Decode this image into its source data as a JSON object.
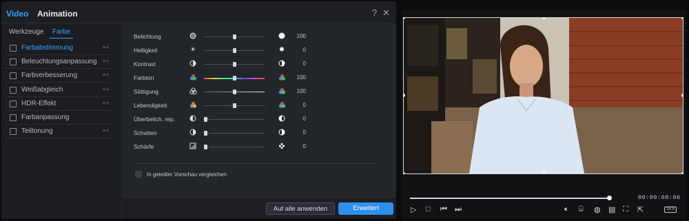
{
  "header": {
    "tabs": [
      {
        "label": "Video",
        "active": true
      },
      {
        "label": "Animation",
        "active": false
      }
    ],
    "help_icon": "question-icon",
    "close_icon": "close-icon"
  },
  "sidebar": {
    "subtabs": [
      {
        "label": "Werkzeuge",
        "active": false
      },
      {
        "label": "Farbe",
        "active": true
      }
    ],
    "items": [
      {
        "label": "Farbabstimmung",
        "active": true,
        "reset": true
      },
      {
        "label": "Beleuchtungsanpassung",
        "active": false,
        "reset": true
      },
      {
        "label": "Farbverbesserung",
        "active": false,
        "reset": true
      },
      {
        "label": "Weißabgleich",
        "active": false,
        "reset": true
      },
      {
        "label": "HDR-Effekt",
        "active": false,
        "reset": true
      },
      {
        "label": "Farbanpassung",
        "active": false,
        "reset": false
      },
      {
        "label": "Teiltonung",
        "active": false,
        "reset": true
      }
    ]
  },
  "adjustments": [
    {
      "label": "Belichtung",
      "value": "100",
      "level": 0.5,
      "left_icon": "exposure-low-icon",
      "right_icon": "exposure-high-icon"
    },
    {
      "label": "Helligkeit",
      "value": "0",
      "level": 0.5,
      "left_icon": "brightness-low-icon",
      "right_icon": "brightness-high-icon"
    },
    {
      "label": "Kontrast",
      "value": "0",
      "level": 0.5,
      "left_icon": "contrast-low-icon",
      "right_icon": "contrast-high-icon"
    },
    {
      "label": "Farbton",
      "value": "100",
      "level": 0.5,
      "left_icon": "hue-icon",
      "right_icon": "hue-icon"
    },
    {
      "label": "Sättigung",
      "value": "100",
      "level": 0.5,
      "left_icon": "saturation-low-icon",
      "right_icon": "saturation-high-icon"
    },
    {
      "label": "Lebendigkeit",
      "value": "0",
      "level": 0.5,
      "left_icon": "vibrance-low-icon",
      "right_icon": "vibrance-high-icon"
    },
    {
      "label": "Überbelich. rep.",
      "value": "0",
      "level": 0.0,
      "left_icon": "highlight-low-icon",
      "right_icon": "highlight-high-icon"
    },
    {
      "label": "Schatten",
      "value": "0",
      "level": 0.0,
      "left_icon": "shadow-low-icon",
      "right_icon": "shadow-high-icon"
    },
    {
      "label": "Schärfe",
      "value": "0",
      "level": 0.0,
      "left_icon": "sharpness-low-icon",
      "right_icon": "sharpness-high-icon"
    }
  ],
  "compare": {
    "label": "In geteilter Vorschau vergleichen",
    "checked": false
  },
  "footer": {
    "apply_label": "Auf alle anwenden",
    "advanced_label": "Erweitert"
  },
  "player": {
    "timecode": "00:00:08:06",
    "progress": 0.99,
    "aspect_label": "16:9",
    "controls_left": [
      "play-icon",
      "stop-icon",
      "previous-frame-icon",
      "next-frame-icon"
    ],
    "controls_right": [
      "volume-icon",
      "snapshot-icon",
      "render-preview-icon",
      "subtitle-icon",
      "crop-icon",
      "fullscreen-icon"
    ]
  },
  "colors": {
    "accent": "#3f9cf5",
    "button_primary": "#2f8fef",
    "panel": "#1d1f24",
    "preview_bg": "#111214"
  }
}
